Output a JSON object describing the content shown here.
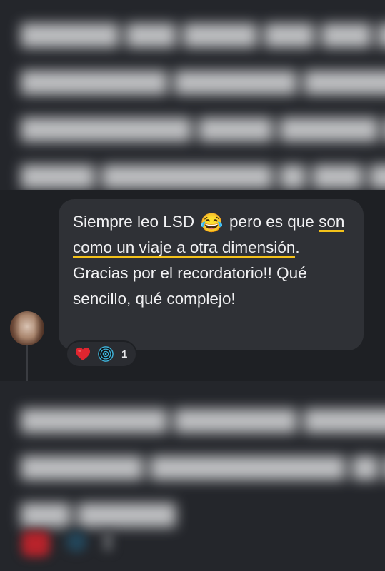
{
  "comment": {
    "text_segments": [
      {
        "text": "Siempre leo LSD ",
        "highlight": false
      },
      {
        "emoji": "😂",
        "emoji_name": "tears-of-joy-emoji"
      },
      {
        "text": " pero es que ",
        "highlight": false
      },
      {
        "text": "son como un viaje a otra dimensión",
        "highlight": true
      },
      {
        "text": ". Gracias por el recordatorio!! Qué sencillo, qué complejo!",
        "highlight": false
      }
    ],
    "highlight_color": "#f4c21a",
    "reactions": {
      "icons": [
        "heart-icon",
        "target-icon"
      ],
      "count": "1"
    }
  },
  "colors": {
    "bubble": "#2f3136",
    "background": "#1e2024",
    "text": "#f1f1f3",
    "heart": "#e0252f"
  }
}
